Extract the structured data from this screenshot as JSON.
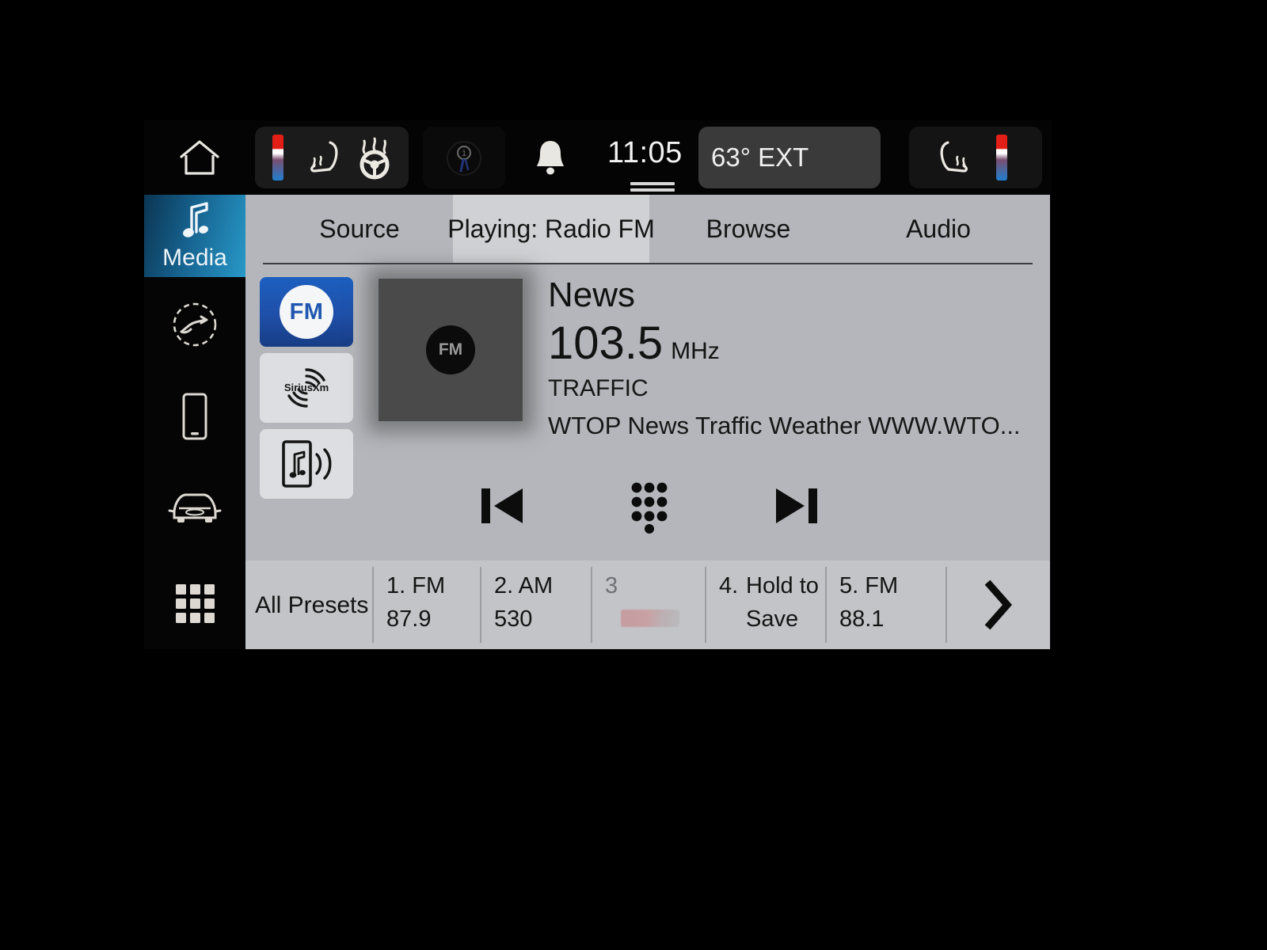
{
  "status_bar": {
    "home_icon": "home-icon",
    "driver_seat_heat_icon": "heated-seat-icon",
    "steering_wheel_heat_icon": "heated-steering-wheel-icon",
    "dim_indicator_icon": "climate-indicator-icon",
    "notification_icon": "bell-icon",
    "clock": "11:05",
    "exterior_temp": "63° EXT",
    "passenger_seat_heat_icon": "heated-seat-icon",
    "drag_handle": "drag-handle"
  },
  "sidebar": {
    "items": [
      {
        "label": "Media",
        "icon": "music-note-icon",
        "active": true
      },
      {
        "label": "",
        "icon": "navigation-icon",
        "active": false
      },
      {
        "label": "",
        "icon": "phone-icon",
        "active": false
      },
      {
        "label": "",
        "icon": "vehicle-icon",
        "active": false
      },
      {
        "label": "",
        "icon": "apps-grid-icon",
        "active": false
      }
    ]
  },
  "tabs": [
    {
      "label": "Source",
      "active": false
    },
    {
      "label": "Playing: Radio FM",
      "active": true
    },
    {
      "label": "Browse",
      "active": false
    },
    {
      "label": "Audio",
      "active": false
    }
  ],
  "sources": [
    {
      "label": "FM",
      "icon": "fm-icon",
      "active": true
    },
    {
      "label": "SiriusXM",
      "icon": "siriusxm-icon",
      "active": false
    },
    {
      "label": "Bluetooth Audio",
      "icon": "bluetooth-audio-icon",
      "active": false
    }
  ],
  "album_art": {
    "badge": "FM"
  },
  "now_playing": {
    "station_name": "News",
    "frequency": "103.5",
    "unit": "MHz",
    "genre": "TRAFFIC",
    "radio_text": "WTOP News Traffic Weather WWW.WTO..."
  },
  "transport": {
    "previous": "previous-track-icon",
    "keypad": "direct-tune-keypad-icon",
    "next": "next-track-icon"
  },
  "presets": {
    "all_label": "All Presets",
    "items": [
      {
        "num": "1. FM",
        "value": "87.9",
        "empty": false
      },
      {
        "num": "2. AM",
        "value": "530",
        "empty": false
      },
      {
        "num": "3",
        "value": "",
        "empty": true
      },
      {
        "num": "4.",
        "sub": "Hold to",
        "value": "Save",
        "empty": false
      },
      {
        "num": "5. FM",
        "value": "88.1",
        "empty": false
      }
    ],
    "next_page_icon": "chevron-right-icon"
  },
  "colors": {
    "accent_blue": "#1f57b0",
    "sidebar_active": "#2899c8",
    "panel_bg": "#b4b6bb",
    "preset_bg": "#c2c4c7",
    "text_dark": "#121212"
  }
}
